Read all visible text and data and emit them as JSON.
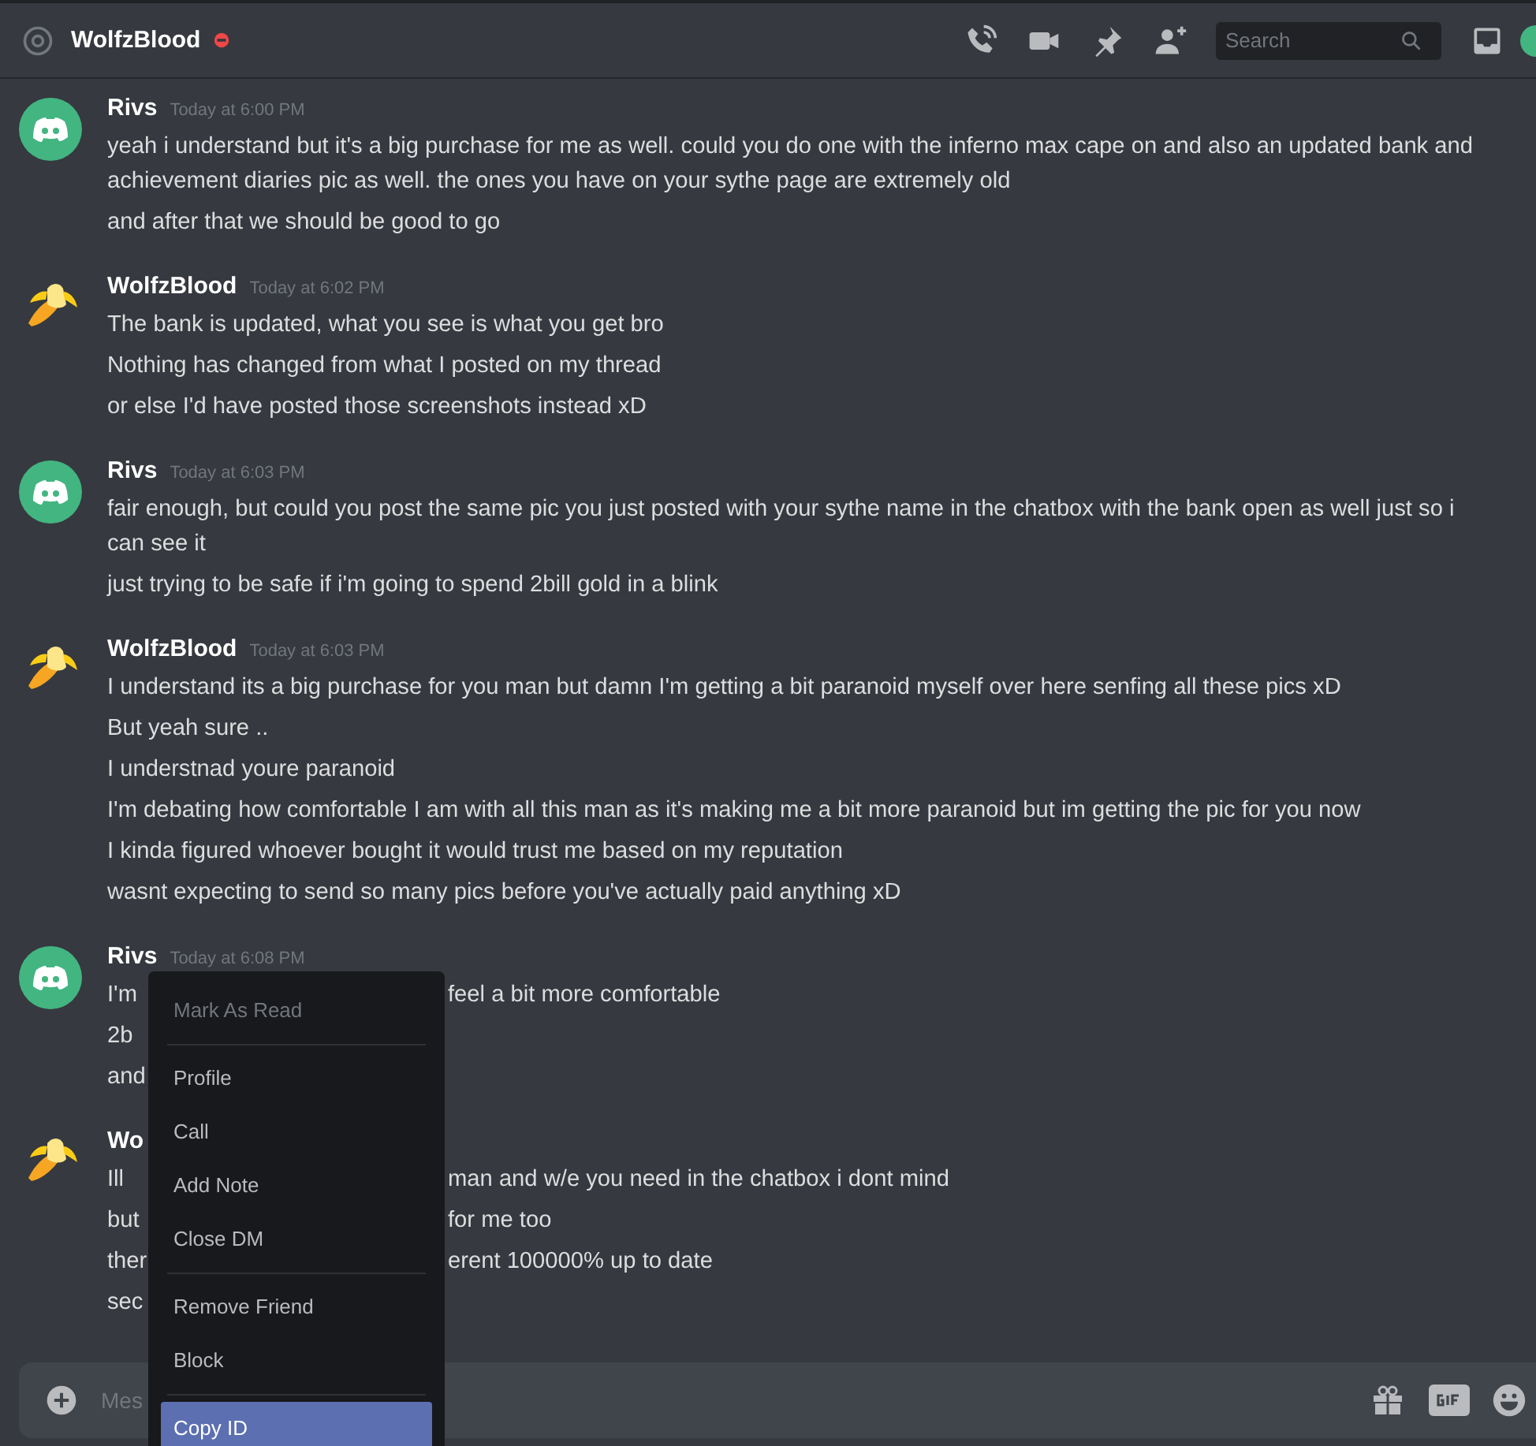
{
  "header": {
    "title": "WolfzBlood",
    "search": {
      "placeholder": "Search"
    }
  },
  "groups": [
    {
      "author": "Rivs",
      "kind": "discord",
      "timestamp": "Today at 6:00 PM",
      "messages": [
        {
          "text": "yeah i understand but it's a big purchase for me as well. could you do one with the inferno max cape on and also an updated bank and achievement diaries pic as well. the ones you have on your sythe page are extremely old"
        },
        {
          "text": "and after that we should be good to go"
        }
      ]
    },
    {
      "author": "WolfzBlood",
      "kind": "banana",
      "timestamp": "Today at 6:02 PM",
      "messages": [
        {
          "text": "The bank is updated, what you see is what you get bro"
        },
        {
          "text": "Nothing has changed from what I posted on my thread"
        },
        {
          "text": "or else I'd have posted those screenshots instead xD"
        }
      ]
    },
    {
      "author": "Rivs",
      "kind": "discord",
      "timestamp": "Today at 6:03 PM",
      "messages": [
        {
          "text": "fair enough, but could you post the same pic you just posted with your sythe name in the chatbox with the bank open as well just so i can see it"
        },
        {
          "text": "just trying to be safe if i'm going to spend 2bill gold in a blink"
        }
      ]
    },
    {
      "author": "WolfzBlood",
      "kind": "banana",
      "timestamp": "Today at 6:03 PM",
      "messages": [
        {
          "text": "I understand its a big purchase for you man but damn I'm getting a bit paranoid myself over here senfing all these pics xD"
        },
        {
          "text": "But yeah sure .."
        },
        {
          "text": "I understnad youre paranoid"
        },
        {
          "text": "I'm debating how comfortable I am with all this man as it's making me a bit more paranoid but im getting the pic for you now"
        },
        {
          "text": "I kinda figured whoever bought it would trust me based on my reputation"
        },
        {
          "text": "wasnt expecting to send so many pics before you've actually paid anything xD"
        }
      ]
    },
    {
      "author": "Rivs",
      "kind": "discord",
      "timestamp": "Today at 6:08 PM",
      "messages": [
        {
          "text": "I'm",
          "after": "feel a bit more comfortable"
        },
        {
          "text": "2b"
        },
        {
          "text": "and"
        }
      ]
    },
    {
      "author": "Wo",
      "kind": "banana",
      "messages": [
        {
          "text": "Ill",
          "after": "man and w/e you need in the chatbox i dont mind"
        },
        {
          "text": "but",
          "after": "for me too"
        },
        {
          "text": "ther",
          "after": "erent 100000% up to date"
        },
        {
          "text": "sec"
        }
      ]
    }
  ],
  "composer": {
    "placeholder": "Mes"
  },
  "context_menu": {
    "sections": [
      [
        {
          "label": "Mark As Read",
          "disabled": true,
          "selected": false
        }
      ],
      [
        {
          "label": "Profile",
          "disabled": false,
          "selected": false
        },
        {
          "label": "Call",
          "disabled": false,
          "selected": false
        },
        {
          "label": "Add Note",
          "disabled": false,
          "selected": false
        },
        {
          "label": "Close DM",
          "disabled": false,
          "selected": false
        }
      ],
      [
        {
          "label": "Remove Friend",
          "disabled": false,
          "selected": false
        },
        {
          "label": "Block",
          "disabled": false,
          "selected": false
        }
      ],
      [
        {
          "label": "Copy ID",
          "disabled": false,
          "selected": true
        }
      ]
    ]
  }
}
